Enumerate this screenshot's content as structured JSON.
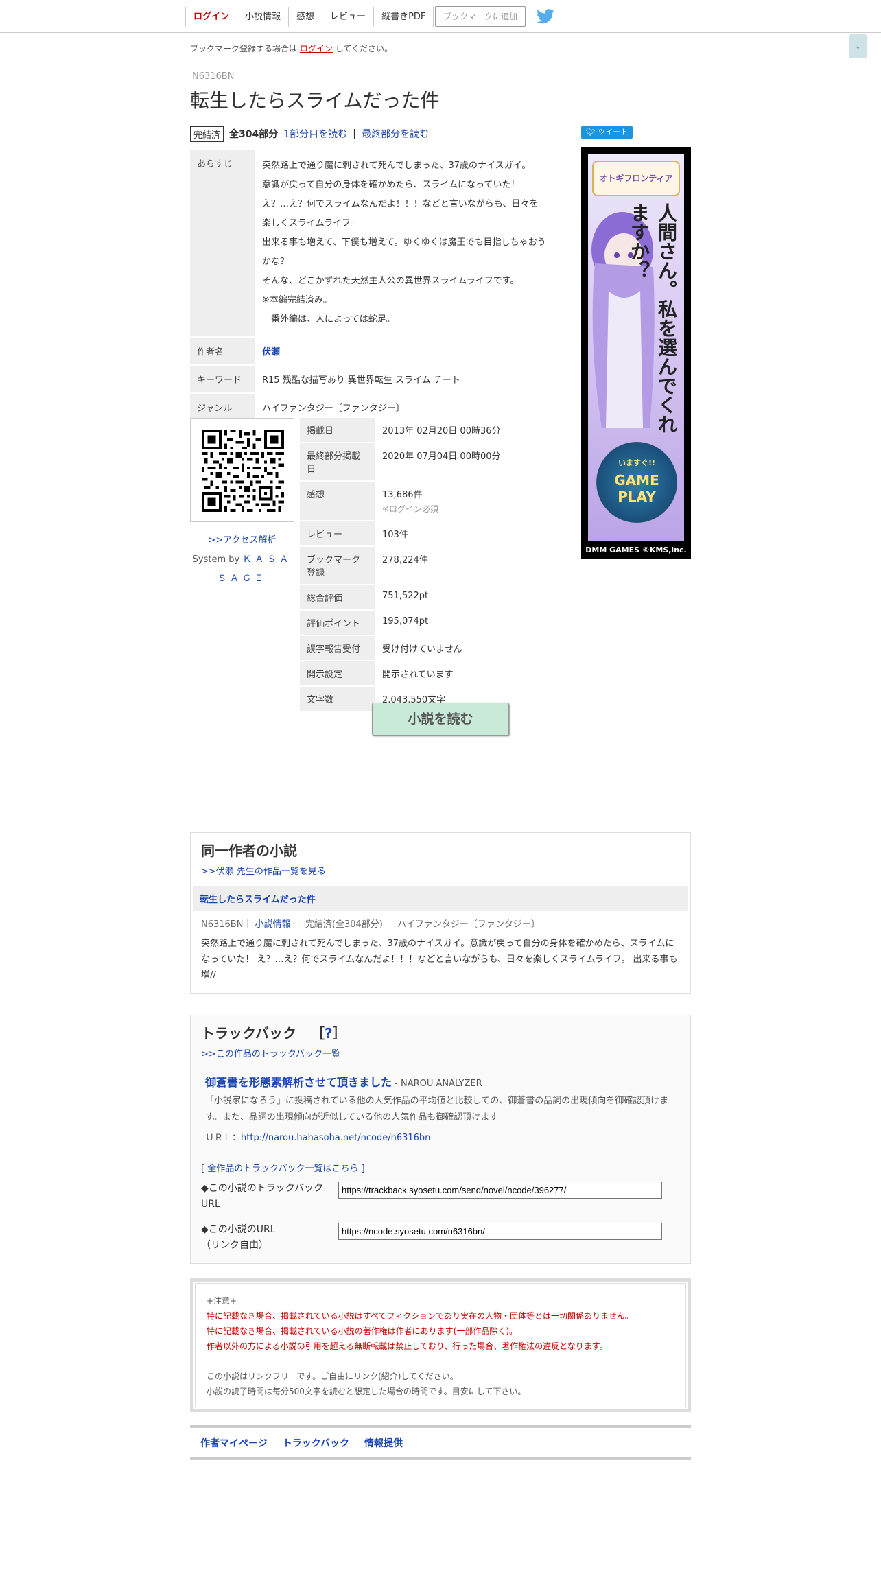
{
  "nav": {
    "items": [
      "ログイン",
      "小説情報",
      "感想",
      "レビュー",
      "縦書きPDF"
    ],
    "bookmark_button": "ブックマークに追加",
    "scroll_down": "↓"
  },
  "bookmark_notice": {
    "prefix": "ブックマーク登録する場合は",
    "link": "ログイン",
    "suffix": "してください。"
  },
  "novel": {
    "ncode": "N6316BN",
    "title": "転生したらスライムだった件",
    "status": "完結済",
    "total_parts": "全304部分",
    "read_first": "1部分目を読む",
    "separator": "|",
    "read_last": "最終部分を読む"
  },
  "tweet_button": "ツイート",
  "info": {
    "synopsis_label": "あらすじ",
    "synopsis": [
      "突然路上で通り魔に刺されて死んでしまった、37歳のナイスガイ。",
      "意識が戻って自分の身体を確かめたら、スライムになっていた！",
      "え？…え？何でスライムなんだよ！！！などと言いながらも、日々を楽しくスライムライフ。",
      "出来る事も増えて、下僕も増えて。ゆくゆくは魔王でも目指しちゃおうかな？",
      "そんな、どこかずれた天然主人公の異世界スライムライフです。",
      "※本編完結済み。",
      "　番外編は、人によっては蛇足。"
    ],
    "author_label": "作者名",
    "author": "伏瀬",
    "keyword_label": "キーワード",
    "keywords": "R15 残酷な描写あり 異世界転生  スライム チート",
    "genre_label": "ジャンル",
    "genre": "ハイファンタジー〔ファンタジー〕"
  },
  "access": {
    "link": ">>アクセス解析",
    "system_prefix": "System by",
    "system_link": "ＫＡＳＡＳＡＧＩ"
  },
  "stats": [
    {
      "label": "掲載日",
      "value": "2013年 02月20日 00時36分"
    },
    {
      "label": "最終部分掲載日",
      "value": "2020年 07月04日 00時00分"
    },
    {
      "label": "感想",
      "value": "13,686件",
      "note": "※ログイン必須"
    },
    {
      "label": "レビュー",
      "value": "103件"
    },
    {
      "label": "ブックマーク登録",
      "value": "278,224件"
    },
    {
      "label": "総合評価",
      "value": "751,522pt"
    },
    {
      "label": "評価ポイント",
      "value": "195,074pt"
    },
    {
      "label": "誤字報告受付",
      "value": "受け付けていません"
    },
    {
      "label": "開示設定",
      "value": "開示されています"
    },
    {
      "label": "文字数",
      "value": "2,043,550文字"
    }
  ],
  "ad": {
    "logo": "オトギフロンティア",
    "tagline": "人間さん。私を選んでくれますか？",
    "play_small": "いますぐ!!",
    "play_big": "GAME PLAY",
    "footer": "DMM GAMES ©KMS,inc."
  },
  "read_button": "小説を読む",
  "same_author": {
    "title": "同一作者の小説",
    "list_link": ">>伏瀬 先生の作品一覧を見る",
    "novel_title": "転生したらスライムだった件",
    "meta_ncode": "N6316BN｜",
    "meta_info_link": "小説情報",
    "meta_rest": "｜ 完結済(全304部分) ｜ ハイファンタジー〔ファンタジー〕",
    "summary": "突然路上で通り魔に刺されて死んでしまった、37歳のナイスガイ。意識が戻って自分の身体を確かめたら、スライムになっていた！ え？…え？何でスライムなんだよ！！！などと言いながらも、日々を楽しくスライムライフ。 出来る事も増//"
  },
  "trackback": {
    "title": "トラックバック",
    "help_open": "［",
    "help": "?",
    "help_close": "］",
    "list_link": ">>この作品のトラックバック一覧",
    "entry_title": "御蒼書を形態素解析させて頂きました",
    "entry_source": " - NAROU ANALYZER",
    "entry_desc": "「小説家になろう」に投稿されている他の人気作品の平均値と比較しての、御蒼書の品詞の出現傾向を御確認頂けます。また、品詞の出現傾向が近似している他の人気作品も御確認頂けます",
    "entry_url_label": "ＵＲＬ：",
    "entry_url": "http://narou.hahasoha.net/ncode/n6316bn",
    "all_link": "[ 全作品のトラックバック一覧はこちら ]",
    "tb_url_label_1": "◆この小説のトラックバック",
    "tb_url_label_2": "URL",
    "tb_url_value": "https://trackback.syosetu.com/send/novel/ncode/396277/",
    "novel_url_label_1": "◆この小説のURL",
    "novel_url_label_2": "（リンク自由）",
    "novel_url_value": "https://ncode.syosetu.com/n6316bn/"
  },
  "notice": {
    "heading": "+注意+",
    "red_lines": [
      "特に記載なき場合、掲載されている小説はすべてフィクションであり実在の人物・団体等とは一切関係ありません。",
      "特に記載なき場合、掲載されている小説の著作権は作者にあります(一部作品除く)。",
      "作者以外の方による小説の引用を超える無断転載は禁止しており、行った場合、著作権法の違反となります。"
    ],
    "gray_lines": [
      "この小説はリンクフリーです。ご自由にリンク(紹介)してください。",
      "小説の読了時間は毎分500文字を読むと想定した場合の時間です。目安にして下さい。"
    ]
  },
  "footer": [
    "作者マイページ",
    "トラックバック",
    "情報提供"
  ]
}
